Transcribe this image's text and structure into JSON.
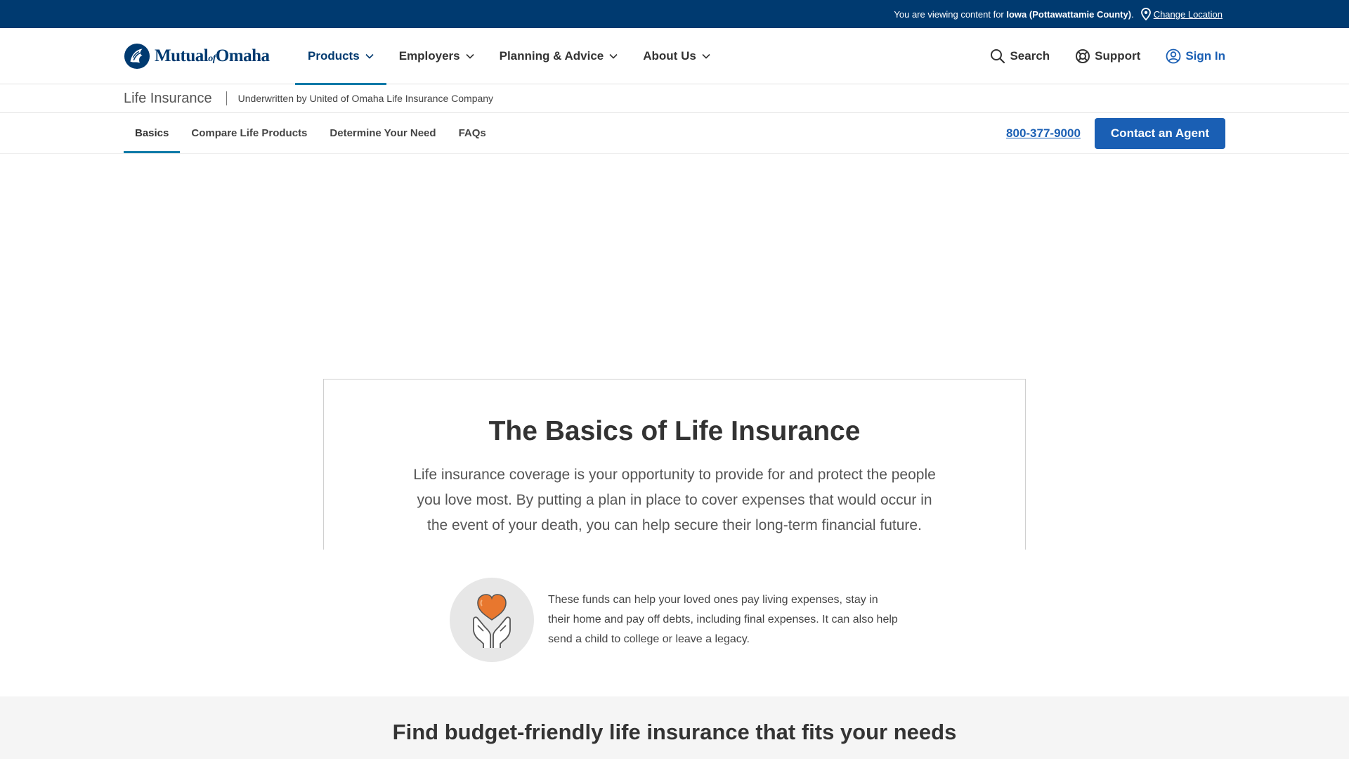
{
  "topbar": {
    "viewing_prefix": "You are viewing content for",
    "location": "Iowa (Pottawattamie County)",
    "location_suffix": ".",
    "change_location": "Change Location"
  },
  "header": {
    "logo": {
      "mutual": "Mutual",
      "of": "of",
      "omaha": "Omaha"
    },
    "nav": [
      {
        "label": "Products"
      },
      {
        "label": "Employers"
      },
      {
        "label": "Planning & Advice"
      },
      {
        "label": "About Us"
      }
    ],
    "utility": {
      "search": "Search",
      "support": "Support",
      "signin": "Sign In"
    }
  },
  "product_bar": {
    "title": "Life Insurance",
    "subtitle": "Underwritten by United of Omaha Life Insurance Company"
  },
  "subnav": {
    "tabs": [
      {
        "label": "Basics"
      },
      {
        "label": "Compare Life Products"
      },
      {
        "label": "Determine Your Need"
      },
      {
        "label": "FAQs"
      }
    ],
    "phone": "800-377-9000",
    "cta": "Contact an Agent"
  },
  "basics": {
    "title": "The Basics of Life Insurance",
    "body": "Life insurance coverage is your opportunity to provide for and protect the people you love most. By putting a plan in place to cover expenses that would occur in the event of your death, you can help secure their long-term financial future."
  },
  "feature": {
    "icon": "heart-hands-icon",
    "text": "These funds can help your loved ones pay living expenses, stay in their home and pay off debts, including final expenses. It can also help send a child to college or leave a legacy."
  },
  "bottom": {
    "title": "Find budget-friendly life insurance that fits your needs"
  },
  "colors": {
    "topbar": "#003a70",
    "brand_blue": "#1a5fb4",
    "accent_teal": "#0f7aa8",
    "heart_orange": "#e8772e"
  }
}
